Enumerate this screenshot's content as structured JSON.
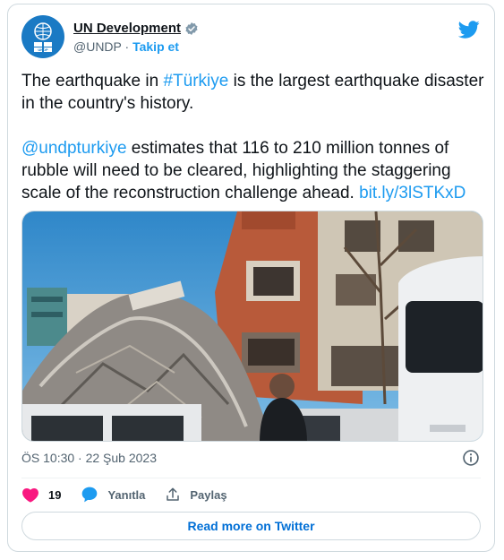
{
  "account": {
    "name": "UN Development",
    "handle": "@UNDP",
    "separator": "·",
    "follow_label": "Takip et",
    "avatar_text": "UNDP"
  },
  "tweet": {
    "line1_pre": "The earthquake in ",
    "line1_hashtag": "#Türkiye",
    "line1_post": " is the largest earthquake disaster in the country's history.",
    "mention": "@undpturkiye",
    "line2": " estimates that 116 to 210 million tonnes of rubble will need to be cleared, highlighting the staggering scale of the reconstruction challenge ahead. ",
    "link": "bit.ly/3lSTKxD"
  },
  "meta": {
    "timestamp": "ÖS 10:30 · 22 Şub 2023"
  },
  "actions": {
    "likes_count": "19",
    "reply_label": "Yanıtla",
    "share_label": "Paylaş"
  },
  "read_more_label": "Read more on Twitter",
  "colors": {
    "accent": "#1d9bf0",
    "like": "#f91880",
    "avatar_bg": "#1a7ac4"
  },
  "icons": [
    "un-emblem-icon",
    "verified-badge-icon",
    "twitter-bird-icon",
    "info-icon",
    "heart-icon",
    "reply-bubble-icon",
    "share-icon"
  ]
}
